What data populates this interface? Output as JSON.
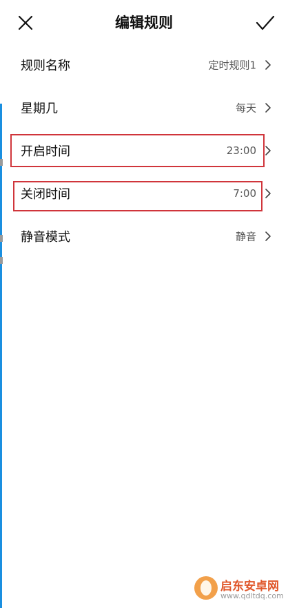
{
  "header": {
    "title": "编辑规则",
    "close_icon": "close-icon",
    "confirm_icon": "check-icon"
  },
  "rows": [
    {
      "label": "规则名称",
      "value": "定时规则1"
    },
    {
      "label": "星期几",
      "value": "每天"
    },
    {
      "label": "开启时间",
      "value": "23:00"
    },
    {
      "label": "关闭时间",
      "value": "7:00"
    },
    {
      "label": "静音模式",
      "value": "静音"
    }
  ],
  "colors": {
    "highlight": "#d0353b",
    "edge": "#1a8fe0"
  },
  "watermark": {
    "name": "启东安卓网",
    "url": "www.qdltdq.com"
  }
}
